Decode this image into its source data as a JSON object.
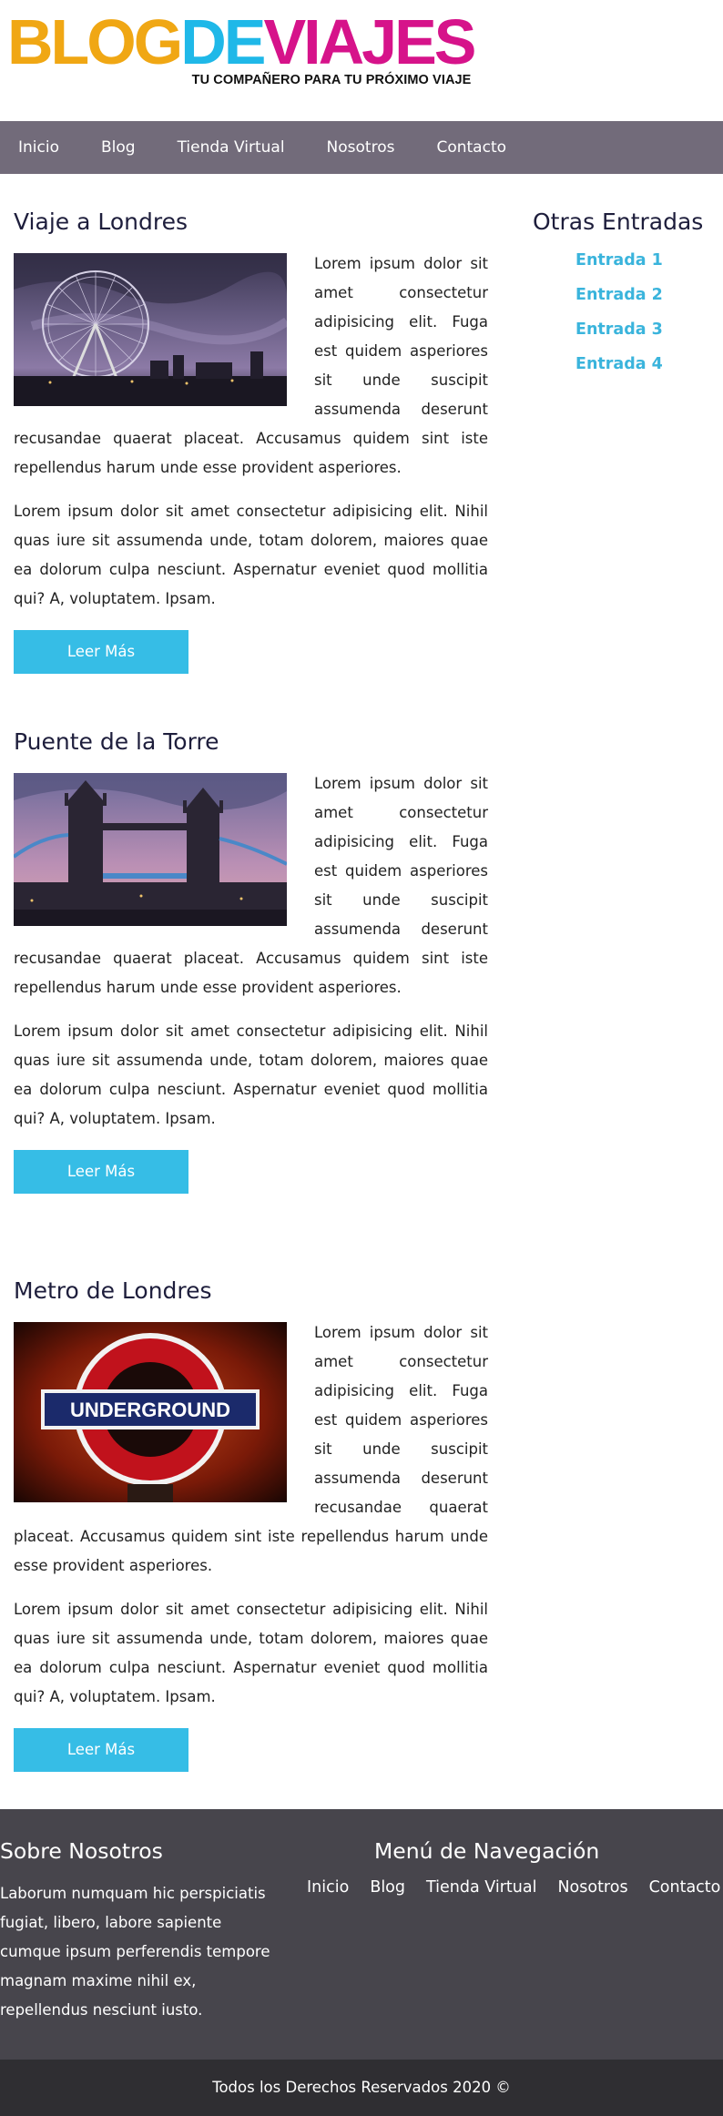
{
  "logo": {
    "part1": "BLOG",
    "part2": "DE",
    "part3": "VIAJES",
    "tagline": "TU COMPAÑERO PARA TU PRÓXIMO VIAJE"
  },
  "nav": {
    "items": [
      "Inicio",
      "Blog",
      "Tienda Virtual",
      "Nosotros",
      "Contacto"
    ]
  },
  "posts": [
    {
      "title": "Viaje a Londres",
      "image": "london-eye-photo",
      "p1": "Lorem ipsum dolor sit amet consectetur adipisicing elit. Fuga est quidem asperiores sit unde suscipit assumenda deserunt recusandae quaerat placeat. Accusamus quidem sint iste repellendus harum unde esse provident asperiores.",
      "p2": "Lorem ipsum dolor sit amet consectetur adipisicing elit. Nihil quas iure sit assumenda unde, totam dolorem, maiores quae ea dolorum culpa nesciunt. Aspernatur eveniet quod mollitia qui? A, voluptatem. Ipsam.",
      "button": "Leer Más"
    },
    {
      "title": "Puente de la Torre",
      "image": "tower-bridge-photo",
      "p1": "Lorem ipsum dolor sit amet consectetur adipisicing elit. Fuga est quidem asperiores sit unde suscipit assumenda deserunt recusandae quaerat placeat. Accusamus quidem sint iste repellendus harum unde esse provident asperiores.",
      "p2": "Lorem ipsum dolor sit amet consectetur adipisicing elit. Nihil quas iure sit assumenda unde, totam dolorem, maiores quae ea dolorum culpa nesciunt. Aspernatur eveniet quod mollitia qui? A, voluptatem. Ipsam.",
      "button": "Leer Más"
    },
    {
      "title": "Metro de Londres",
      "image": "underground-sign-photo",
      "image_text": "UNDERGROUND",
      "p1": "Lorem ipsum dolor sit amet consectetur adipisicing elit. Fuga est quidem asperiores sit unde suscipit assumenda deserunt recusandae quaerat placeat. Accusamus quidem sint iste repellendus harum unde esse provident asperiores.",
      "p2": "Lorem ipsum dolor sit amet consectetur adipisicing elit. Nihil quas iure sit assumenda unde, totam dolorem, maiores quae ea dolorum culpa nesciunt. Aspernatur eveniet quod mollitia qui? A, voluptatem. Ipsam.",
      "button": "Leer Más"
    }
  ],
  "sidebar": {
    "title": "Otras Entradas",
    "items": [
      "Entrada 1",
      "Entrada 2",
      "Entrada 3",
      "Entrada 4"
    ]
  },
  "footer": {
    "about_title": "Sobre Nosotros",
    "about_text": "Laborum numquam hic perspiciatis fugiat, libero, labore sapiente cumque ipsum perferendis tempore magnam maxime nihil ex, repellendus nesciunt iusto.",
    "nav_title": "Menú de Navegación",
    "nav_items": [
      "Inicio",
      "Blog",
      "Tienda Virtual",
      "Nosotros",
      "Contacto"
    ],
    "copyright": "Todos los Derechos Reservados 2020 ©"
  },
  "colors": {
    "nav_bg": "#726b7a",
    "accent": "#36bde6",
    "footer_bg": "#47454c",
    "copyright_bg": "#2f2e32",
    "logo_orange": "#f0a714",
    "logo_blue": "#1fb8e8",
    "logo_pink": "#d6138a"
  }
}
